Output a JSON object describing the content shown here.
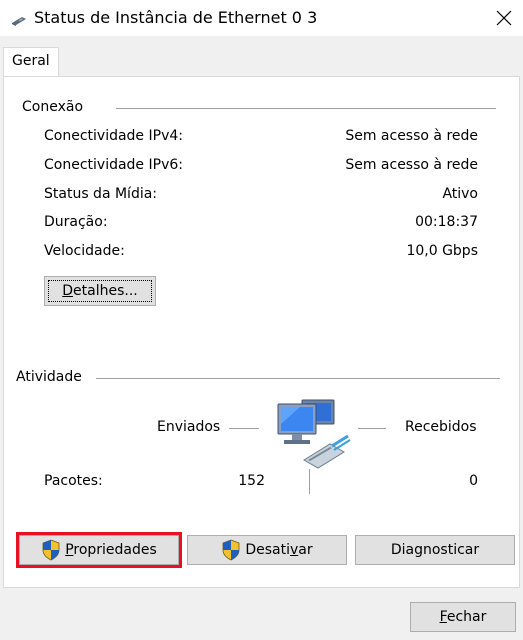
{
  "window": {
    "title": "Status de Instância de Ethernet 0 3",
    "icon": "network-adapter-icon"
  },
  "tabs": [
    {
      "label": "Geral",
      "selected": true
    }
  ],
  "connection": {
    "heading": "Conexão",
    "rows": [
      {
        "label": "Conectividade IPv4:",
        "value": "Sem acesso à rede"
      },
      {
        "label": "Conectividade IPv6:",
        "value": "Sem acesso à rede"
      },
      {
        "label": "Status da Mídia:",
        "value": "Ativo"
      },
      {
        "label": "Duração:",
        "value": "00:18:37"
      },
      {
        "label": "Velocidade:",
        "value": "10,0 Gbps"
      }
    ],
    "details_button": {
      "pre": "",
      "underline": "D",
      "post": "etalhes..."
    }
  },
  "activity": {
    "heading": "Atividade",
    "sent_label": "Enviados",
    "received_label": "Recebidos",
    "packets_label": "Pacotes:",
    "packets_sent": "152",
    "packets_received": "0",
    "icon": "network-computers-icon"
  },
  "buttons": {
    "properties": {
      "pre": "",
      "underline": "P",
      "post": "ropriedades",
      "icon": "uac-shield-icon"
    },
    "disable": {
      "pre": "Desati",
      "underline": "v",
      "post": "ar",
      "icon": "uac-shield-icon"
    },
    "diagnose": {
      "label": "Diagnosticar"
    },
    "close": {
      "pre": "",
      "underline": "F",
      "post": "echar"
    }
  },
  "colors": {
    "highlight": "#e81123",
    "button_face": "#e1e1e1",
    "button_border": "#adadad"
  }
}
